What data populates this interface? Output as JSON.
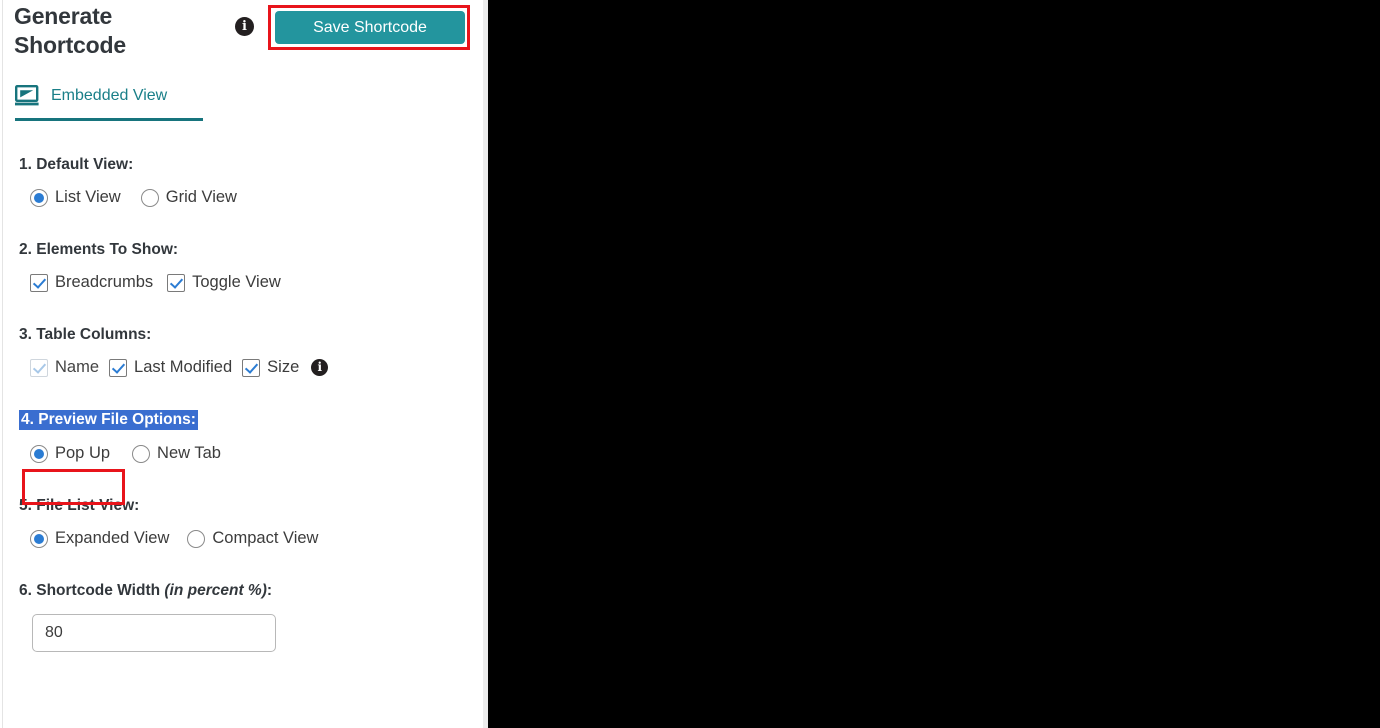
{
  "header": {
    "title": "Generate Shortcode",
    "info_icon": "info-icon",
    "info_glyph": "i",
    "save_label": "Save Shortcode",
    "accent_color": "#23959e",
    "annotation_color": "#e8141b"
  },
  "tabs": [
    {
      "label": "Embedded View",
      "icon": "monitor-icon",
      "active": true
    }
  ],
  "options": [
    {
      "number": "1.",
      "title": "1. Default View:",
      "type": "radio",
      "choices": [
        {
          "label": "List View",
          "selected": true
        },
        {
          "label": "Grid View",
          "selected": false
        }
      ]
    },
    {
      "number": "2.",
      "title": "2. Elements To Show:",
      "type": "checkbox",
      "choices": [
        {
          "label": "Breadcrumbs",
          "checked": true,
          "disabled": false
        },
        {
          "label": "Toggle View",
          "checked": true,
          "disabled": false
        }
      ]
    },
    {
      "number": "3.",
      "title": "3. Table Columns:",
      "type": "checkbox",
      "has_info_icon": true,
      "info_glyph": "i",
      "choices": [
        {
          "label": "Name",
          "checked": true,
          "disabled": true
        },
        {
          "label": "Last Modified",
          "checked": true,
          "disabled": false
        },
        {
          "label": "Size",
          "checked": true,
          "disabled": false
        }
      ]
    },
    {
      "number": "4.",
      "title": "4. Preview File Options:",
      "type": "radio",
      "title_highlighted": true,
      "highlight_color": "#3a6ed0",
      "choices": [
        {
          "label": "Pop Up",
          "selected": true,
          "annotated": true
        },
        {
          "label": "New Tab",
          "selected": false
        }
      ]
    },
    {
      "number": "5.",
      "title": "5. File List View:",
      "type": "radio",
      "choices": [
        {
          "label": "Expanded View",
          "selected": true
        },
        {
          "label": "Compact View",
          "selected": false
        }
      ]
    },
    {
      "number": "6.",
      "title_plain": "6. Shortcode Width ",
      "title_italic": "(in percent %)",
      "title_tail": ":",
      "type": "text",
      "value": "80",
      "placeholder": ""
    }
  ]
}
